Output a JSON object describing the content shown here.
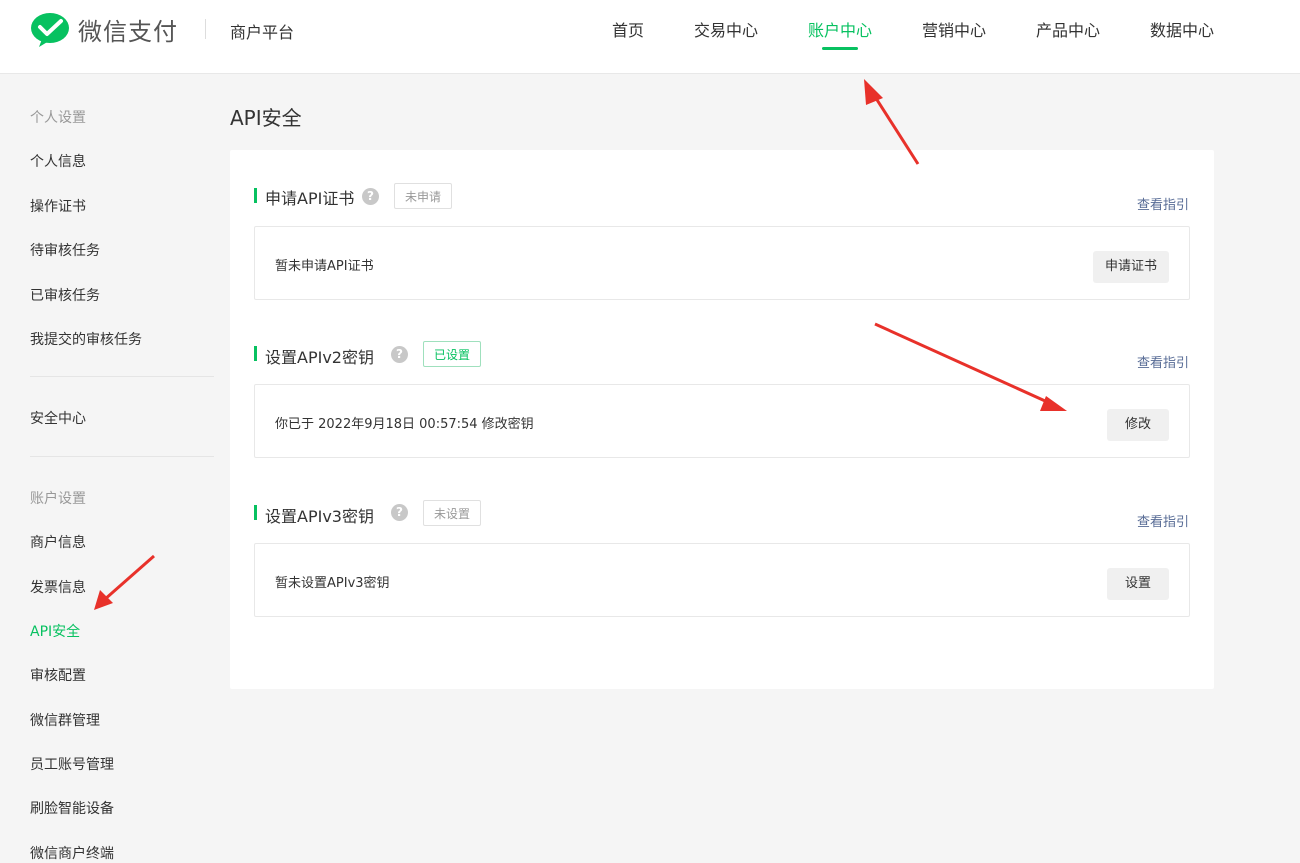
{
  "header": {
    "brand_name": "微信支付",
    "platform_name": "商户平台",
    "nav": [
      {
        "label": "首页",
        "active": false
      },
      {
        "label": "交易中心",
        "active": false
      },
      {
        "label": "账户中心",
        "active": true
      },
      {
        "label": "营销中心",
        "active": false
      },
      {
        "label": "产品中心",
        "active": false
      },
      {
        "label": "数据中心",
        "active": false
      }
    ]
  },
  "sidebar": {
    "group_personal": "个人设置",
    "personal_items": [
      "个人信息",
      "操作证书",
      "待审核任务",
      "已审核任务",
      "我提交的审核任务"
    ],
    "security_center": "安全中心",
    "group_account": "账户设置",
    "account_items": [
      "商户信息",
      "发票信息",
      "API安全",
      "审核配置",
      "微信群管理",
      "员工账号管理",
      "刷脸智能设备",
      "微信商户终端"
    ],
    "active_item": "API安全"
  },
  "main": {
    "page_title": "API安全",
    "sections": [
      {
        "title": "申请API证书",
        "status": "未申请",
        "guide_link": "查看指引",
        "description": "暂未申请API证书",
        "button": "申请证书"
      },
      {
        "title": "设置APIv2密钥",
        "status": "已设置",
        "guide_link": "查看指引",
        "description": "你已于 2022年9月18日 00:57:54 修改密钥",
        "button": "修改"
      },
      {
        "title": "设置APIv3密钥",
        "status": "未设置",
        "guide_link": "查看指引",
        "description": "暂未设置APIv3密钥",
        "button": "设置"
      }
    ]
  },
  "icons": {
    "logo": "wechat-pay-logo",
    "help": "question-circle-icon",
    "help_glyph": "?"
  },
  "colors": {
    "accent": "#07c160",
    "link": "#576b95",
    "annotation": "#e8312a"
  }
}
